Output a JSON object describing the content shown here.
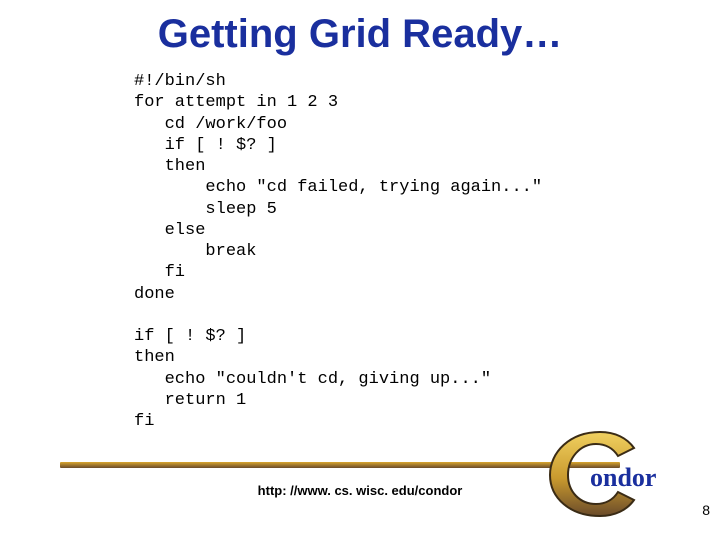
{
  "title": "Getting Grid Ready…",
  "code": "#!/bin/sh\nfor attempt in 1 2 3\n   cd /work/foo\n   if [ ! $? ]\n   then\n       echo \"cd failed, trying again...\"\n       sleep 5\n   else\n       break\n   fi\ndone\n\nif [ ! $? ]\nthen\n   echo \"couldn't cd, giving up...\"\n   return 1\nfi",
  "footer_url": "http: //www. cs. wisc. edu/condor",
  "page_number": "8",
  "logo_text_tail": "ondor"
}
